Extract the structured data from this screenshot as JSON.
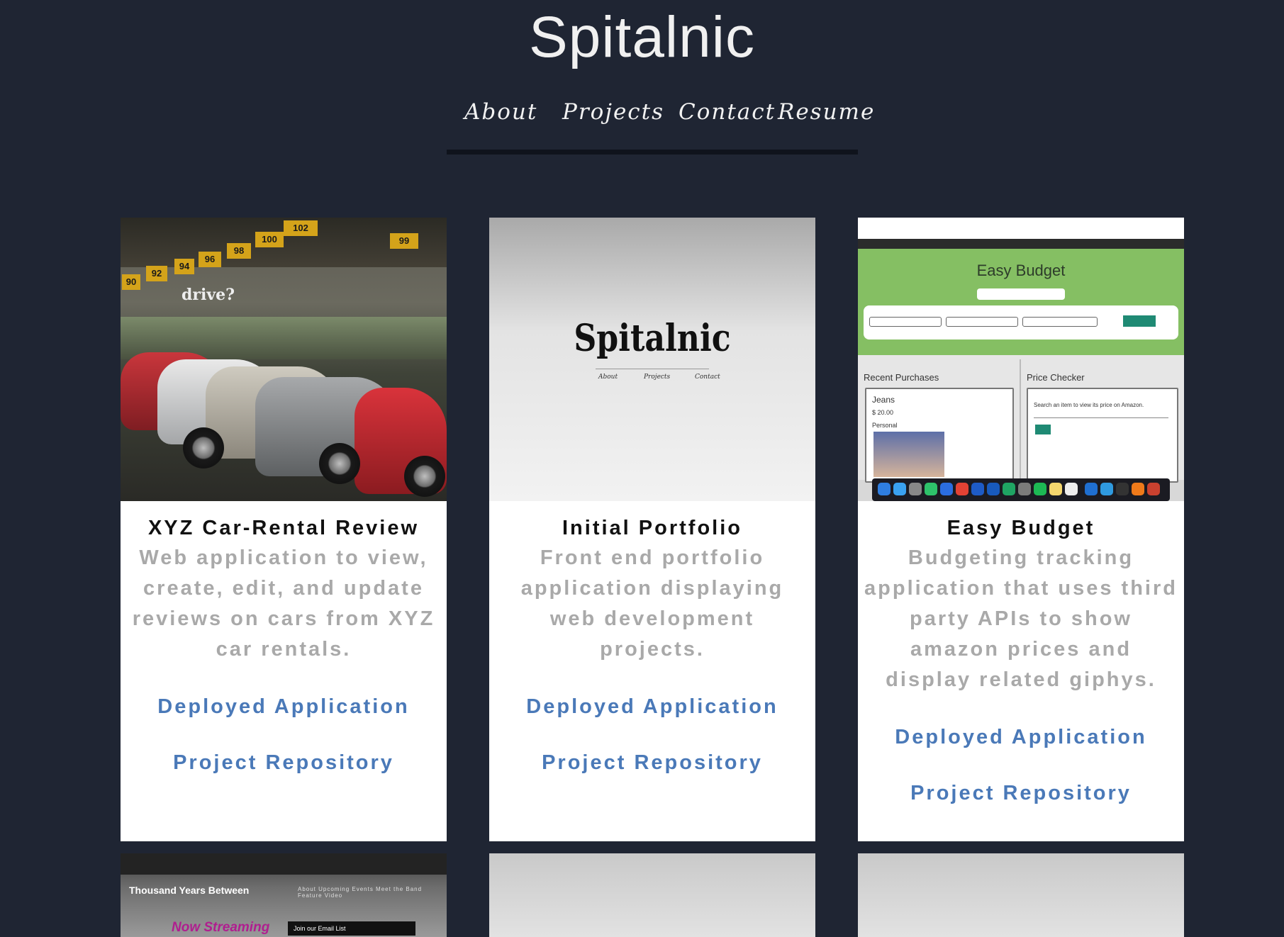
{
  "site": {
    "title": "Spitalnic"
  },
  "nav": {
    "items": [
      "About",
      "Projects",
      "Contact",
      "Resume"
    ]
  },
  "projects": [
    {
      "title": "XYZ Car-Rental Review",
      "description": "Web application to view, create, edit, and update reviews on cars from XYZ car rentals.",
      "deployed_label": "Deployed Application",
      "repo_label": "Project Repository",
      "image": {
        "bay_numbers": [
          "102",
          "100",
          "99",
          "98",
          "96",
          "94",
          "92",
          "90"
        ],
        "sign_text": "drive?"
      }
    },
    {
      "title": "Initial Portfolio",
      "description": "Front end portfolio application displaying web development projects.",
      "deployed_label": "Deployed Application",
      "repo_label": "Project Repository",
      "image": {
        "title": "Spitalnic",
        "nav": [
          "About",
          "Projects",
          "Contact"
        ]
      }
    },
    {
      "title": "Easy Budget",
      "description": "Budgeting tracking application that uses third party APIs to show amazon prices and display related giphys.",
      "deployed_label": "Deployed Application",
      "repo_label": "Project Repository",
      "image": {
        "title": "Easy Budget",
        "recent_heading": "Recent Purchases",
        "price_heading": "Price Checker",
        "item_name": "Jeans",
        "item_price": "$ 20.00",
        "item_category": "Personal",
        "price_prompt": "Search an item to view its price on Amazon."
      }
    },
    {
      "image": {
        "title": "Thousand Years Between",
        "menu": "About  Upcoming Events  Meet the Band  Feature Video",
        "streaming": "Now Streaming",
        "email": "Join our Email List"
      }
    },
    {},
    {}
  ],
  "colors": {
    "background": "#1f2533",
    "card": "#ffffff",
    "title_text": "#111111",
    "description_text": "#a9a9a9",
    "link": "#4a79b8",
    "nav_text": "#f2f2f2",
    "budget_green": "#85bf63"
  }
}
